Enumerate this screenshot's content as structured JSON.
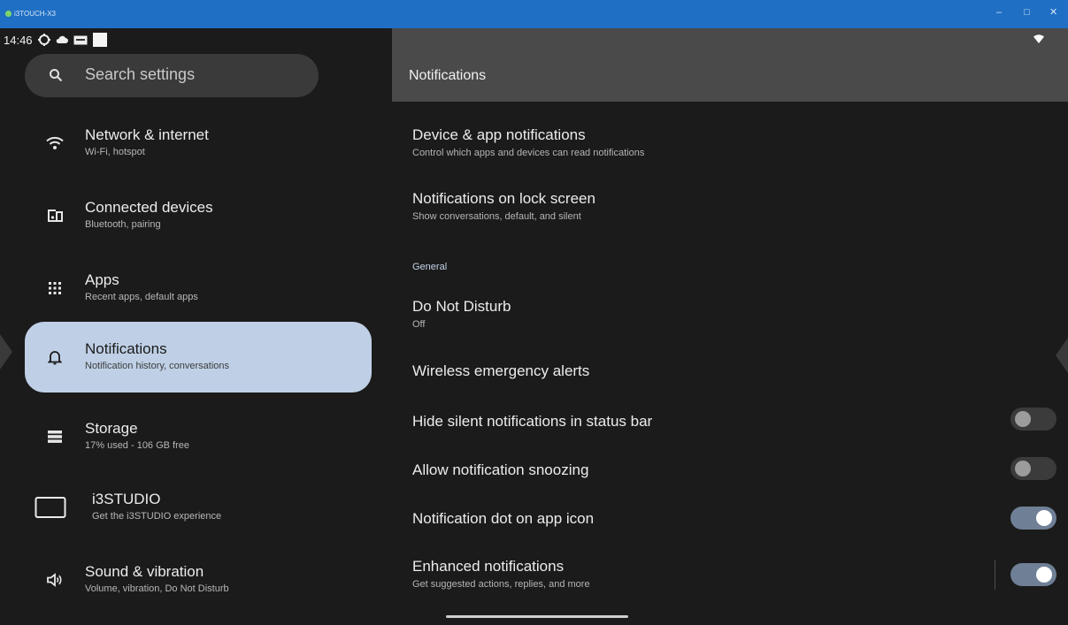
{
  "window": {
    "title": "i3TOUCH-X3",
    "controls": {
      "minimize": "–",
      "maximize": "□",
      "close": "✕"
    }
  },
  "status_bar": {
    "time": "14:46"
  },
  "search": {
    "placeholder": "Search settings"
  },
  "sidebar": {
    "items": [
      {
        "title": "Network & internet",
        "subtitle": "Wi-Fi, hotspot",
        "icon": "wifi-icon"
      },
      {
        "title": "Connected devices",
        "subtitle": "Bluetooth, pairing",
        "icon": "connected-devices-icon"
      },
      {
        "title": "Apps",
        "subtitle": "Recent apps, default apps",
        "icon": "apps-grid-icon"
      },
      {
        "title": "Notifications",
        "subtitle": "Notification history, conversations",
        "icon": "bell-icon",
        "selected": true
      },
      {
        "title": "Storage",
        "subtitle": "17% used - 106 GB free",
        "icon": "storage-icon"
      },
      {
        "title": "i3STUDIO",
        "subtitle": "Get the i3STUDIO experience",
        "icon": "i3studio-icon"
      },
      {
        "title": "Sound & vibration",
        "subtitle": "Volume, vibration, Do Not Disturb",
        "icon": "speaker-icon"
      }
    ]
  },
  "main": {
    "title": "Notifications",
    "rows_top": [
      {
        "title": "Device & app notifications",
        "subtitle": "Control which apps and devices can read notifications"
      },
      {
        "title": "Notifications on lock screen",
        "subtitle": "Show conversations, default, and silent"
      }
    ],
    "section_general": "General",
    "dnd": {
      "title": "Do Not Disturb",
      "subtitle": "Off"
    },
    "emergency": {
      "title": "Wireless emergency alerts"
    },
    "toggles": [
      {
        "title": "Hide silent notifications in status bar",
        "on": false
      },
      {
        "title": "Allow notification snoozing",
        "on": false
      },
      {
        "title": "Notification dot on app icon",
        "on": true
      },
      {
        "title": "Enhanced notifications",
        "subtitle": "Get suggested actions, replies, and more",
        "on": true
      }
    ]
  },
  "colors": {
    "accent_selected": "#bfd0e6",
    "toggle_on": "#6f8096",
    "titlebar": "#1f6fc4"
  }
}
